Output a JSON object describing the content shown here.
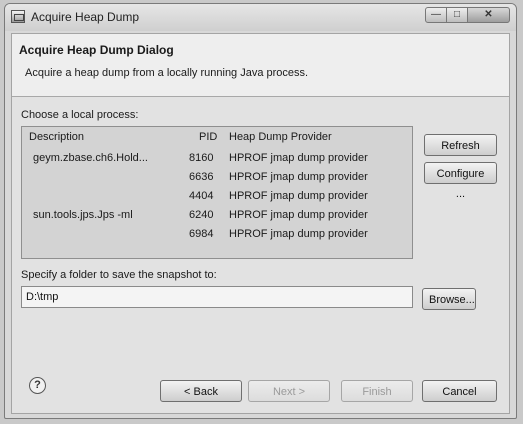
{
  "window": {
    "title": "Acquire Heap Dump"
  },
  "header": {
    "title": "Acquire Heap Dump Dialog",
    "description": "Acquire a heap dump from a locally running Java process."
  },
  "process_section": {
    "label": "Choose a local process:",
    "columns": [
      "Description",
      "PID",
      "Heap Dump Provider"
    ],
    "rows": [
      {
        "description": "geym.zbase.ch6.Hold...",
        "pid": "8160",
        "provider": "HPROF jmap dump provider"
      },
      {
        "description": "",
        "pid": "6636",
        "provider": "HPROF jmap dump provider"
      },
      {
        "description": "",
        "pid": "4404",
        "provider": "HPROF jmap dump provider"
      },
      {
        "description": "sun.tools.jps.Jps -ml",
        "pid": "6240",
        "provider": "HPROF jmap dump provider"
      },
      {
        "description": "",
        "pid": "6984",
        "provider": "HPROF jmap dump provider"
      }
    ],
    "refresh_label": "Refresh",
    "configure_label": "Configure ..."
  },
  "folder_section": {
    "label": "Specify a folder to save the snapshot to:",
    "value": "D:\\tmp",
    "browse_label": "Browse..."
  },
  "footer": {
    "back_label": "< Back",
    "next_label": "Next >",
    "finish_label": "Finish",
    "cancel_label": "Cancel",
    "help_glyph": "?"
  },
  "icons": [
    "app-icon",
    "help-icon"
  ]
}
